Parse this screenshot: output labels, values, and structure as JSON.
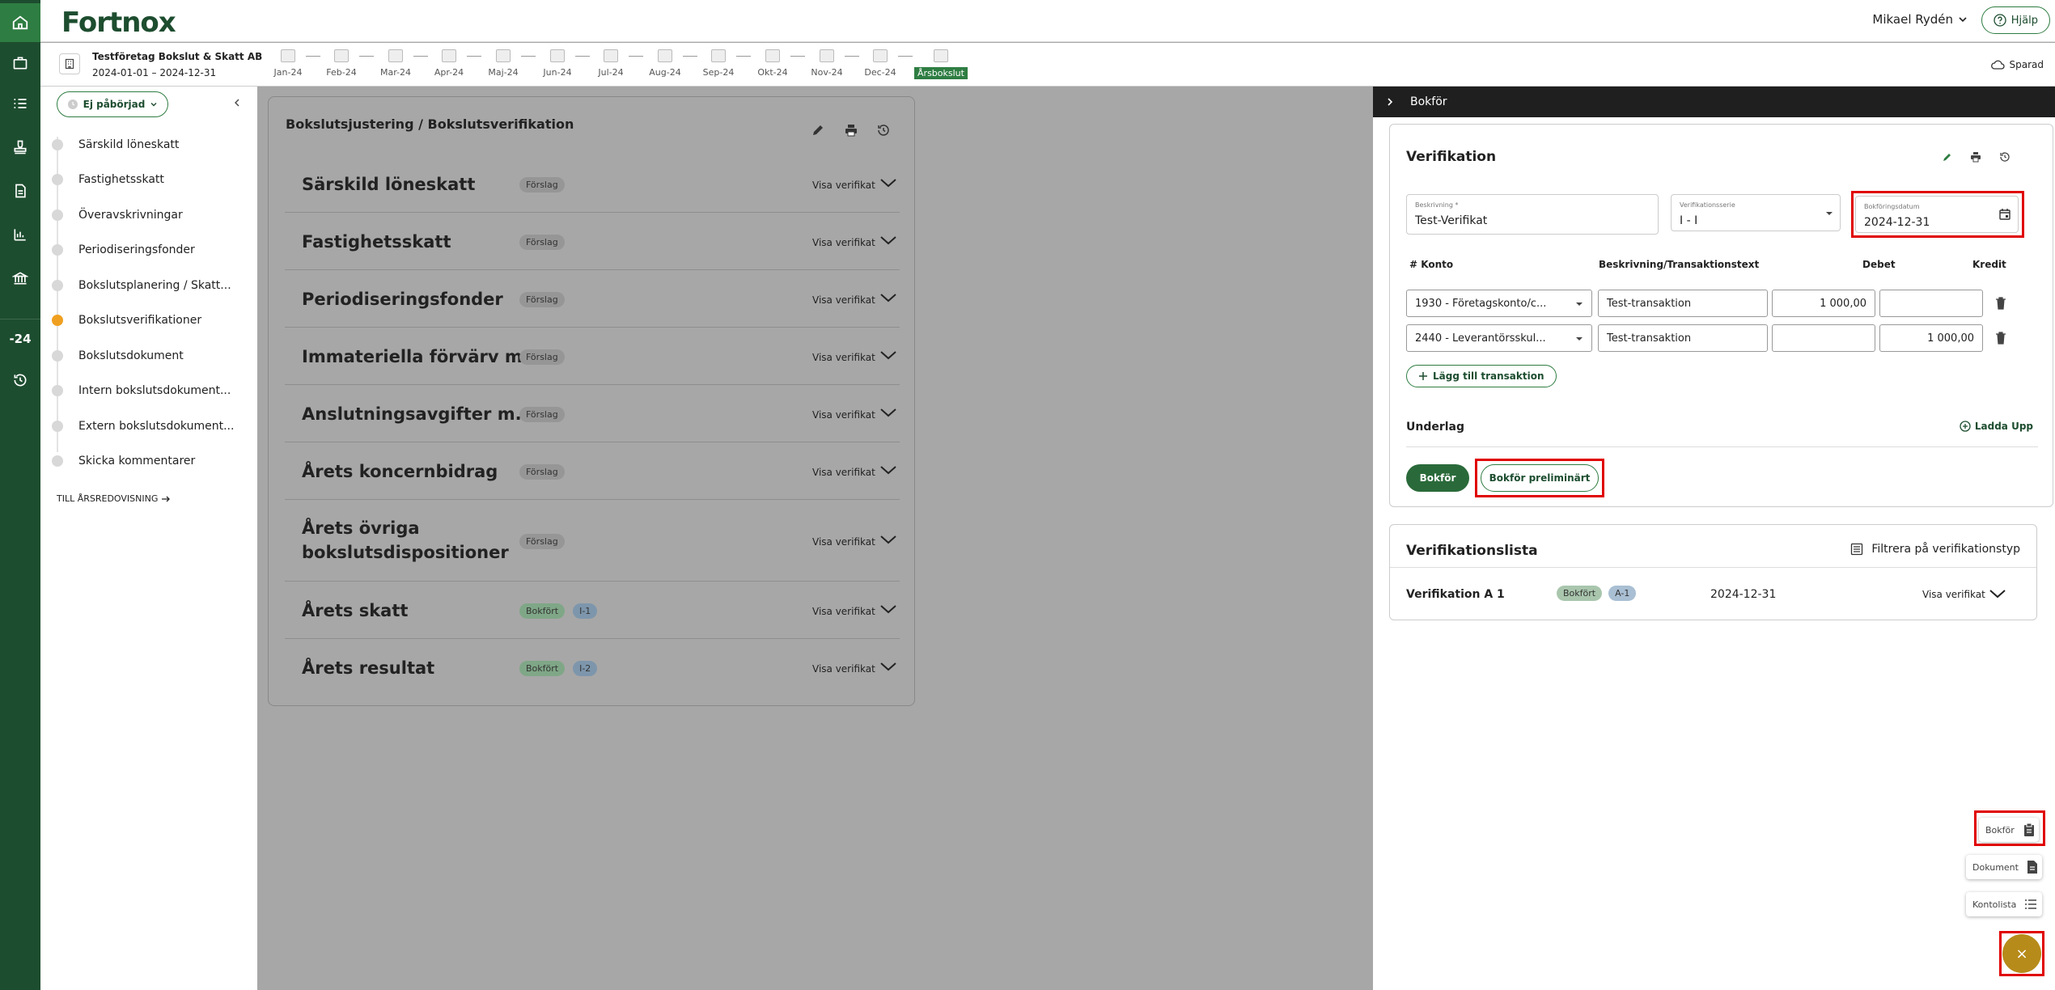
{
  "app": {
    "logo": "Fortnox"
  },
  "header": {
    "user_name": "Mikael Rydén",
    "help_label": "Hjälp",
    "saved_label": "Sparad"
  },
  "company": {
    "name": "Testföretag Bokslut & Skatt AB",
    "period": "2024-01-01 – 2024-12-31"
  },
  "left_nav": {
    "year_label": "-24"
  },
  "timeline": {
    "months": [
      "Jan-24",
      "Feb-24",
      "Mar-24",
      "Apr-24",
      "Maj-24",
      "Jun-24",
      "Jul-24",
      "Aug-24",
      "Sep-24",
      "Okt-24",
      "Nov-24",
      "Dec-24",
      "Årsbokslut"
    ],
    "active": "Årsbokslut"
  },
  "sidebar": {
    "status_label": "Ej påbörjad",
    "steps": [
      "Särskild löneskatt",
      "Fastighetsskatt",
      "Överavskrivningar",
      "Periodiseringsfonder",
      "Bokslutsplanering / Skatt...",
      "Bokslutsverifikationer",
      "Bokslutsdokument",
      "Intern bokslutsdokument...",
      "Extern bokslutsdokument...",
      "Skicka kommentarer"
    ],
    "active_step": "Bokslutsverifikationer",
    "footer_link": "TILL ÅRSREDOVISNING"
  },
  "main": {
    "title": "Bokslutsjustering / Bokslutsverifikation",
    "show_label": "Visa verifikat",
    "items": [
      {
        "title": "Särskild löneskatt",
        "badges": [
          "Förslag"
        ]
      },
      {
        "title": "Fastighetsskatt",
        "badges": [
          "Förslag"
        ]
      },
      {
        "title": "Periodiseringsfonder",
        "badges": [
          "Förslag"
        ]
      },
      {
        "title": "Immateriella förvärv m.m.",
        "badges": [
          "Förslag"
        ]
      },
      {
        "title": "Anslutningsavgifter m.m.",
        "badges": [
          "Förslag"
        ]
      },
      {
        "title": "Årets koncernbidrag",
        "badges": [
          "Förslag"
        ]
      },
      {
        "title": "Årets övriga bokslutsdispositioner",
        "badges": [
          "Förslag"
        ]
      },
      {
        "title": "Årets skatt",
        "badges": [
          "Bokfört",
          "I-1"
        ]
      },
      {
        "title": "Årets resultat",
        "badges": [
          "Bokfört",
          "I-2"
        ]
      }
    ]
  },
  "right_panel": {
    "header": "Bokför",
    "verification": {
      "title": "Verifikation",
      "description": {
        "label": "Beskrivning *",
        "value": "Test-Verifikat"
      },
      "series": {
        "label": "Verifikationsserie",
        "value": "I - I"
      },
      "date": {
        "label": "Bokföringsdatum",
        "value": "2024-12-31"
      },
      "columns": [
        "# Konto",
        "Beskrivning/Transaktionstext",
        "Debet",
        "Kredit"
      ],
      "rows": [
        {
          "account": "1930 -  Företagskonto/c...",
          "text": "Test-transaktion",
          "debit": "1 000,00",
          "credit": ""
        },
        {
          "account": "2440 -  Leverantörsskul...",
          "text": "Test-transaktion",
          "debit": "",
          "credit": "1 000,00"
        }
      ],
      "add_transaction": "Lägg till transaktion",
      "attachments_label": "Underlag",
      "upload_label": "Ladda Upp",
      "book_button": "Bokför",
      "prelim_button": "Bokför preliminärt"
    },
    "list": {
      "title": "Verifikationslista",
      "filter_label": "Filtrera på verifikationstyp",
      "item": {
        "name": "Verifikation A 1",
        "badges": [
          "Bokfört",
          "A-1"
        ],
        "date": "2024-12-31",
        "show_label": "Visa verifikat"
      }
    }
  },
  "fab": {
    "items": [
      "Bokför",
      "Dokument",
      "Kontolista"
    ],
    "close_label": "×"
  },
  "colors": {
    "brand_green": "#1d4d2f",
    "accent_green": "#2e7d42",
    "highlight_red": "#e00000",
    "fab_gold": "#b78b1a",
    "active_step": "#f0a020"
  }
}
